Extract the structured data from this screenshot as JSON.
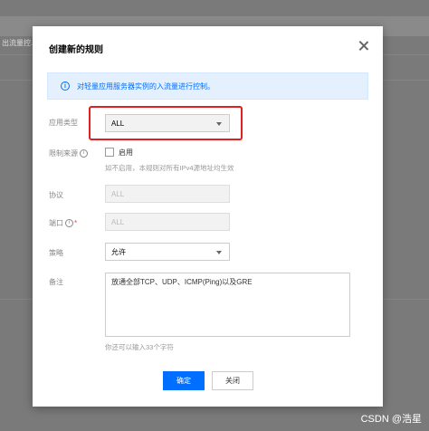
{
  "background": {
    "tab_label": "出流量控..."
  },
  "dialog": {
    "title": "创建新的规则",
    "info_text": "对轻量应用服务器实例的入流量进行控制。",
    "fields": {
      "app_type": {
        "label": "应用类型",
        "value": "ALL"
      },
      "source_limit": {
        "label": "限制来源",
        "checkbox_label": "启用",
        "hint": "如不启用，本规则对所有IPv4源地址均生效"
      },
      "protocol": {
        "label": "协议",
        "value": "ALL"
      },
      "port": {
        "label": "端口",
        "value": "ALL"
      },
      "policy": {
        "label": "策略",
        "value": "允许"
      },
      "note": {
        "label": "备注",
        "value": "放通全部TCP、UDP、ICMP(Ping)以及GRE",
        "counter": "你还可以输入33个字符"
      }
    },
    "buttons": {
      "confirm": "确定",
      "close": "关闭"
    }
  },
  "watermark": "CSDN @浩星",
  "colors": {
    "primary": "#006eff",
    "highlight": "#e02020",
    "info_bg": "#e5f0ff"
  }
}
